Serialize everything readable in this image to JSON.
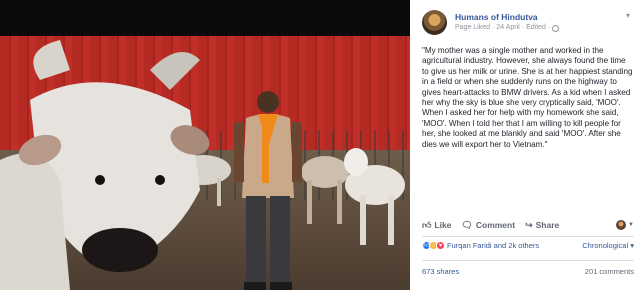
{
  "post": {
    "page_name": "Humans of Hindutva",
    "status": "Page Liked",
    "date": "24 April",
    "edited": "Edited",
    "text": "\"My mother was a single mother and worked in the agricultural industry. However, she always found the time to give us her milk or urine. She is at her happiest standing in a field or when she suddenly runs on the highway to gives heart-attacks to BMW drivers. As a kid when I asked her why the sky is blue she very cryptically said, 'MOO'. When I asked her for help with my homework she said, 'MOO'. When I told her that I am willing to kill people for her, she looked at me blankly and said 'MOO'. After she dies we will export her to Vietnam.\""
  },
  "actions": {
    "like": "Like",
    "comment": "Comment",
    "share": "Share"
  },
  "reactions": {
    "summary": "Furqan Faridi and 2k others",
    "sort": "Chronological"
  },
  "stats": {
    "shares": "673 shares",
    "comments": "201 comments"
  },
  "colors": {
    "link": "#365899",
    "meta": "#90949c",
    "like": "#2078f4"
  }
}
